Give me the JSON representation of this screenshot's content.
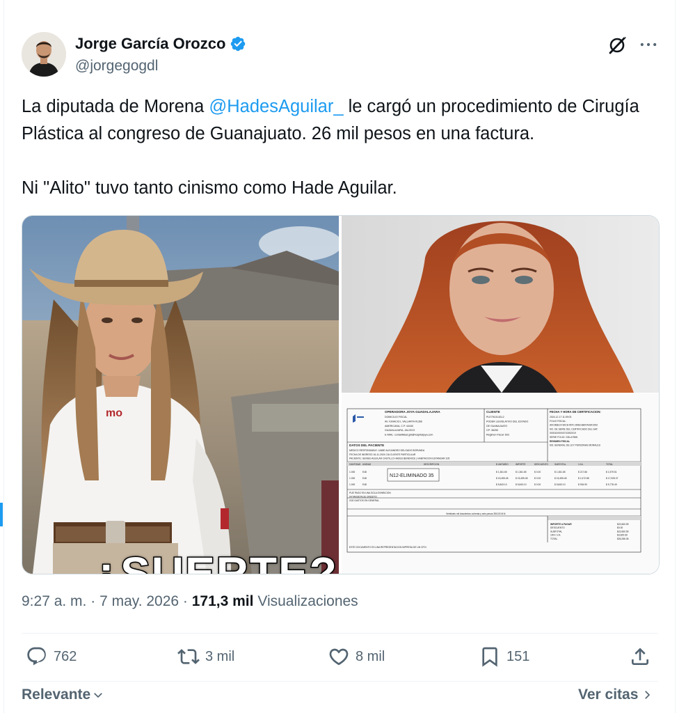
{
  "author": {
    "name": "Jorge García Orozco",
    "handle": "@jorgegogdl"
  },
  "tweet": {
    "text_before_mention": "La diputada de Morena ",
    "mention": "@HadesAguilar_",
    "text_after_mention": " le cargó un procedimiento de Cirugía Plástica al congreso de Guanajuato. 26 mil pesos en una factura.",
    "second_paragraph": "Ni \"Alito\" tuvo tanto cinismo como Hade Aguilar."
  },
  "media": {
    "left_caption": "¿SUERTE?",
    "shirt_logo": "mo",
    "invoice": {
      "issuer_title": "OPERADORA JOYA GUADALAJARA",
      "issuer_lines": [
        "DOMICILIO FISCAL",
        "AV. IGNACIO L VALLARTA #1366",
        "AMERICANA, C.P. 44160",
        "GUADALAJARA, JALISCO",
        "E-MAIL: contabilidad.gdl@hospitaljoya.com"
      ],
      "client_title": "CLIENTE",
      "client_lines": [
        "PLE791014GL2",
        "PODER LEGISLATIVO DEL ESTADO",
        "DE GUANAJUATO",
        "CP: 36250",
        "Régimen Fiscal: 603"
      ],
      "cert_title": "FECHA Y HORA DE CERTIFICACION:",
      "cert_lines": [
        "2024-12-17 11:09:03",
        "FOLIO FISCAL:",
        "A0C9BEC4-90C8-457C-8963-B807A03F2292",
        "NO. DE SERIE DEL CERTIFICADO DEL SAT:",
        "00001000000710052019",
        "SERIE FOLIO: GDLA7568",
        "REGIMEN FISCAL",
        "601 GENERAL DE LEY PERSONAS MORALES"
      ],
      "patient_title": "DATOS DEL PACIENTE",
      "patient_lines": [
        "MEDICO RESPONSABLE: JAIME ALEJANDRO DELGADO BORUNDA",
        "FECHA DE INGRESO 16-11-2024   CIA CLIENTE PARTICULAR",
        "PACIENTE: GENSEI AGUILAR CASTILLO HADES BERENICE | HABITACION ESTANDAR 105"
      ],
      "headers": [
        "CANTIDAD",
        "UNIDAD",
        "DESCRIPCION",
        "$ UNITARIO",
        "IMPORTE",
        "DESCUENTO",
        "SUBTOTAL",
        "I.V.A.",
        "TOTAL"
      ],
      "redaction": "N12-ELIMINADO 35",
      "rows": [
        [
          "1.000",
          "E48",
          "$ 1,361.65",
          "$ 1,361.65",
          "$ 0.00",
          "$ 1,361.65",
          "$ 217.86",
          "$ 1,579.51"
        ],
        [
          "1.000",
          "E48",
          "$ 15,455.48",
          "$ 15,455.48",
          "$ 0.00",
          "$ 15,455.48",
          "$ 2,472.88",
          "$ 17,928.37"
        ],
        [
          "1.000",
          "E48",
          "$ 5,843.10",
          "$ 5,843.10",
          "$ 0.00",
          "$ 5,843.10",
          "$ 934.90",
          "$ 5,778.49"
        ]
      ],
      "payment_lines": [
        "PUE PAGO EN UNA SOLA EXHIBICION",
        "04 TARJETA DE CREDITO",
        "G03 GASTOS EN GENERAL"
      ],
      "amount_words": "Veintiseis mil doscientos ochenta y seis pesos 35/100 M.N.",
      "totals_labels": [
        "IMPORTE A PAGAR",
        "DESCUENTO",
        "SUBTOTAL",
        "16% I.V.A.",
        "TOTAL"
      ],
      "totals_values": [
        "$22,660.59",
        "$0.00",
        "$22,660.59",
        "$3,625.69",
        "$26,286.35"
      ],
      "footer": "ESTE DOCUMENTO ES UNA REPRESENTACION IMPRESA DE UN CFDI"
    }
  },
  "meta": {
    "time": "9:27 a. m.",
    "sep": " · ",
    "date": "7 may. 2026",
    "views_count": "171,3 mil",
    "views_label": " Visualizaciones"
  },
  "actions": {
    "replies": "762",
    "reposts": "3 mil",
    "likes": "8 mil",
    "bookmarks": "151"
  },
  "footer": {
    "sort_label": "Relevante",
    "quotes_label": "Ver citas"
  },
  "colors": {
    "accent": "#1d9bf0",
    "secondary_text": "#536471",
    "primary_text": "#0f1419",
    "divider": "#eff3f4"
  }
}
